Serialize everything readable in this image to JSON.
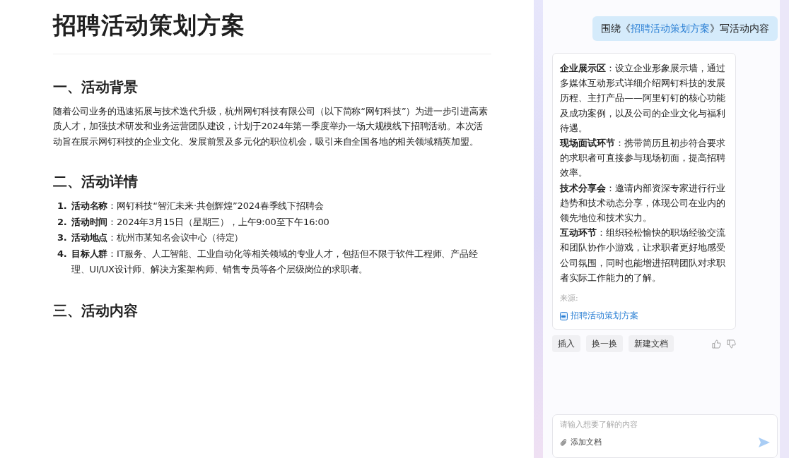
{
  "document": {
    "title": "招聘活动策划方案",
    "sections": [
      {
        "heading": "一、活动背景",
        "paragraph": "随着公司业务的迅速拓展与技术迭代升级，杭州网钉科技有限公司（以下简称“网钉科技”）为进一步引进高素质人才，加强技术研发和业务运营团队建设，计划于2024年第一季度举办一场大规模线下招聘活动。本次活动旨在展示网钉科技的企业文化、发展前景及多元化的职位机会，吸引来自全国各地的相关领域精英加盟。"
      },
      {
        "heading": "二、活动详情",
        "items": [
          {
            "number": "1.",
            "text": "**活动名称**：网钉科技“智汇未来·共创辉煌”2024春季线下招聘会"
          },
          {
            "number": "2.",
            "text": "**活动时间**：2024年3月15日（星期三），上午9:00至下午16:00"
          },
          {
            "number": "3.",
            "text": "**活动地点**：杭州市某知名会议中心（待定）"
          },
          {
            "number": "4.",
            "text": "**目标人群**：IT服务、人工智能、工业自动化等相关领域的专业人才，包括但不限于软件工程师、产品经理、UI/UX设计师、解决方案架构师、销售专员等各个层级岗位的求职者。"
          }
        ]
      },
      {
        "heading": "三、活动内容"
      }
    ]
  },
  "chat": {
    "user_message": {
      "prefix": "围绕《",
      "link": "招聘活动策划方案",
      "suffix": "》写活动内容"
    },
    "answer": {
      "paragraphs": [
        "**企业展示区**：设立企业形象展示墙，通过多媒体互动形式详细介绍网钉科技的发展历程、主打产品——阿里钉钉的核心功能及成功案例，以及公司的企业文化与福利待遇。",
        "**现场面试环节**：携带简历且初步符合要求的求职者可直接参与现场初面，提高招聘效率。",
        "**技术分享会**：邀请内部资深专家进行行业趋势和技术动态分享，体现公司在业内的领先地位和技术实力。",
        "**互动环节**：组织轻松愉快的职场经验交流和团队协作小游戏，让求职者更好地感受公司氛围，同时也能增进招聘团队对求职者实际工作能力的了解。"
      ],
      "source_label": "来源:",
      "source_doc": "招聘活动策划方案"
    },
    "actions": [
      "插入",
      "换一换",
      "新建文档"
    ],
    "input": {
      "placeholder": "请输入想要了解的内容",
      "attach_label": "添加文档"
    }
  }
}
